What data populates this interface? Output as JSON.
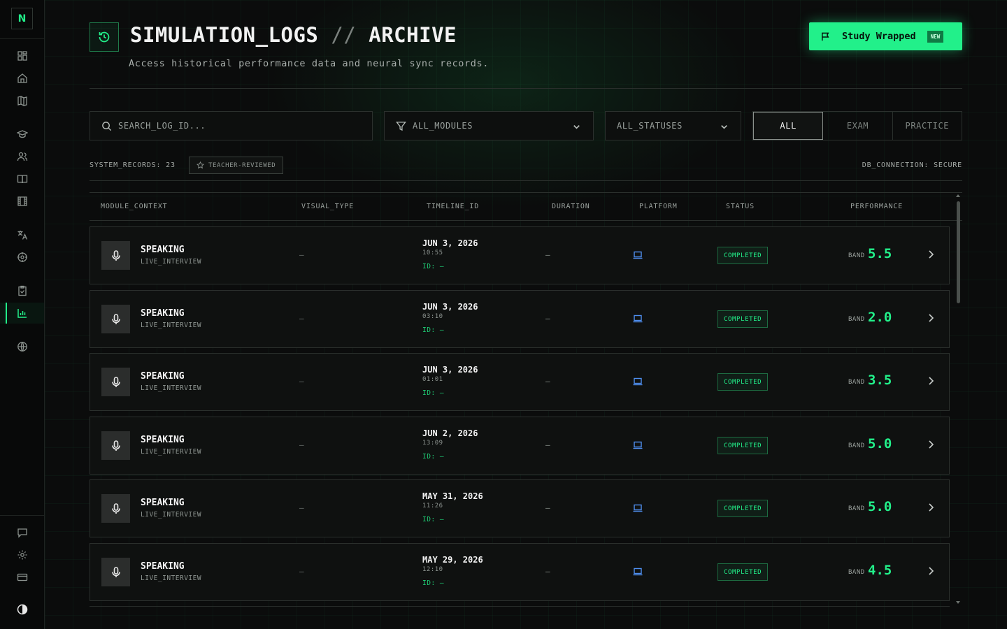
{
  "app": {
    "logo_letter": "N"
  },
  "sidebar": {
    "items": [
      {
        "icon": "dashboard-icon"
      },
      {
        "icon": "home-icon"
      },
      {
        "icon": "map-icon"
      },
      {
        "icon": "graduation-cap-icon"
      },
      {
        "icon": "users-icon"
      },
      {
        "icon": "book-icon"
      },
      {
        "icon": "film-icon"
      },
      {
        "icon": "translate-icon"
      },
      {
        "icon": "target-icon"
      },
      {
        "icon": "clipboard-icon"
      },
      {
        "icon": "bar-chart-icon",
        "active": true
      },
      {
        "icon": "globe-icon"
      }
    ],
    "bottom": [
      {
        "icon": "chat-icon"
      },
      {
        "icon": "settings-icon"
      },
      {
        "icon": "credit-card-icon"
      },
      {
        "icon": "theme-toggle-icon"
      }
    ]
  },
  "header": {
    "title_main": "SIMULATION_LOGS",
    "title_sep": "//",
    "title_sub": "ARCHIVE",
    "subtitle": "Access historical performance data and neural sync records.",
    "cta_label": "Study Wrapped",
    "cta_badge": "NEW"
  },
  "filters": {
    "search_placeholder": "SEARCH_LOG_ID...",
    "module_value": "ALL_MODULES",
    "status_value": "ALL_STATUSES",
    "segments": [
      {
        "label": "ALL",
        "active": true
      },
      {
        "label": "EXAM",
        "active": false
      },
      {
        "label": "PRACTICE",
        "active": false
      }
    ]
  },
  "meta": {
    "records": "SYSTEM_RECORDS: 23",
    "teacher_badge": "TEACHER-REVIEWED",
    "connection": "DB_CONNECTION: SECURE"
  },
  "table": {
    "headers": [
      "MODULE_CONTEXT",
      "VISUAL_TYPE",
      "TIMELINE_ID",
      "DURATION",
      "PLATFORM",
      "STATUS",
      "PERFORMANCE"
    ],
    "rows": [
      {
        "module": "SPEAKING",
        "type": "LIVE_INTERVIEW",
        "visual": "–",
        "date": "JUN 3, 2026",
        "time": "10:55",
        "id": "ID: –",
        "duration": "–",
        "status": "COMPLETED",
        "band_label": "BAND",
        "band": "5.5"
      },
      {
        "module": "SPEAKING",
        "type": "LIVE_INTERVIEW",
        "visual": "–",
        "date": "JUN 3, 2026",
        "time": "03:10",
        "id": "ID: –",
        "duration": "–",
        "status": "COMPLETED",
        "band_label": "BAND",
        "band": "2.0"
      },
      {
        "module": "SPEAKING",
        "type": "LIVE_INTERVIEW",
        "visual": "–",
        "date": "JUN 3, 2026",
        "time": "01:01",
        "id": "ID: –",
        "duration": "–",
        "status": "COMPLETED",
        "band_label": "BAND",
        "band": "3.5"
      },
      {
        "module": "SPEAKING",
        "type": "LIVE_INTERVIEW",
        "visual": "–",
        "date": "JUN 2, 2026",
        "time": "13:09",
        "id": "ID: –",
        "duration": "–",
        "status": "COMPLETED",
        "band_label": "BAND",
        "band": "5.0"
      },
      {
        "module": "SPEAKING",
        "type": "LIVE_INTERVIEW",
        "visual": "–",
        "date": "MAY 31, 2026",
        "time": "11:26",
        "id": "ID: –",
        "duration": "–",
        "status": "COMPLETED",
        "band_label": "BAND",
        "band": "5.0"
      },
      {
        "module": "SPEAKING",
        "type": "LIVE_INTERVIEW",
        "visual": "–",
        "date": "MAY 29, 2026",
        "time": "12:10",
        "id": "ID: –",
        "duration": "–",
        "status": "COMPLETED",
        "band_label": "BAND",
        "band": "4.5"
      }
    ]
  },
  "colors": {
    "accent": "#22f08a",
    "platform": "#4f8ff0",
    "background": "#0b0c0c"
  }
}
